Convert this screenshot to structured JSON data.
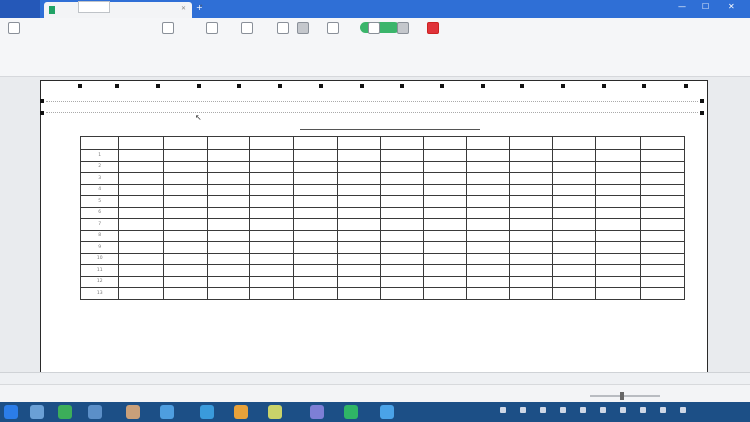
{
  "window": {
    "app_label": "",
    "doc_tab_title": "",
    "new_tab_label": "+",
    "minimize": "—",
    "maximize": "☐",
    "close": "✕",
    "tab_close": "✕"
  },
  "ribbon": {
    "tools": [
      {
        "id": "home",
        "label": ""
      },
      {
        "id": "margins",
        "label": ""
      },
      {
        "id": "orientation",
        "label": ""
      },
      {
        "id": "print-area",
        "label": ""
      },
      {
        "id": "header-footer",
        "label": ""
      },
      {
        "id": "normal-view",
        "label": ""
      },
      {
        "id": "page-break-view",
        "label": ""
      },
      {
        "id": "page-layout",
        "label": ""
      },
      {
        "id": "zoom",
        "label": ""
      },
      {
        "id": "full-screen",
        "label": ""
      },
      {
        "id": "close-preview",
        "label": ""
      }
    ],
    "page_setting_label": "",
    "scale_value": ""
  },
  "sheet": {
    "title": "",
    "headers": [
      "",
      "",
      "",
      "",
      "",
      "",
      "",
      "",
      "",
      "",
      "",
      "",
      "",
      ""
    ],
    "row_numbers": [
      "1",
      "2",
      "3",
      "4",
      "5",
      "6",
      "7",
      "8",
      "9",
      "10",
      "11",
      "12",
      "13"
    ]
  },
  "sheet_tabs": [
    "",
    "",
    ""
  ],
  "colors": {
    "titlebar": "#2f6fd6",
    "accent_green": "#3bb56b",
    "close_red": "#e0333a",
    "taskbar": "#1c4f86"
  }
}
